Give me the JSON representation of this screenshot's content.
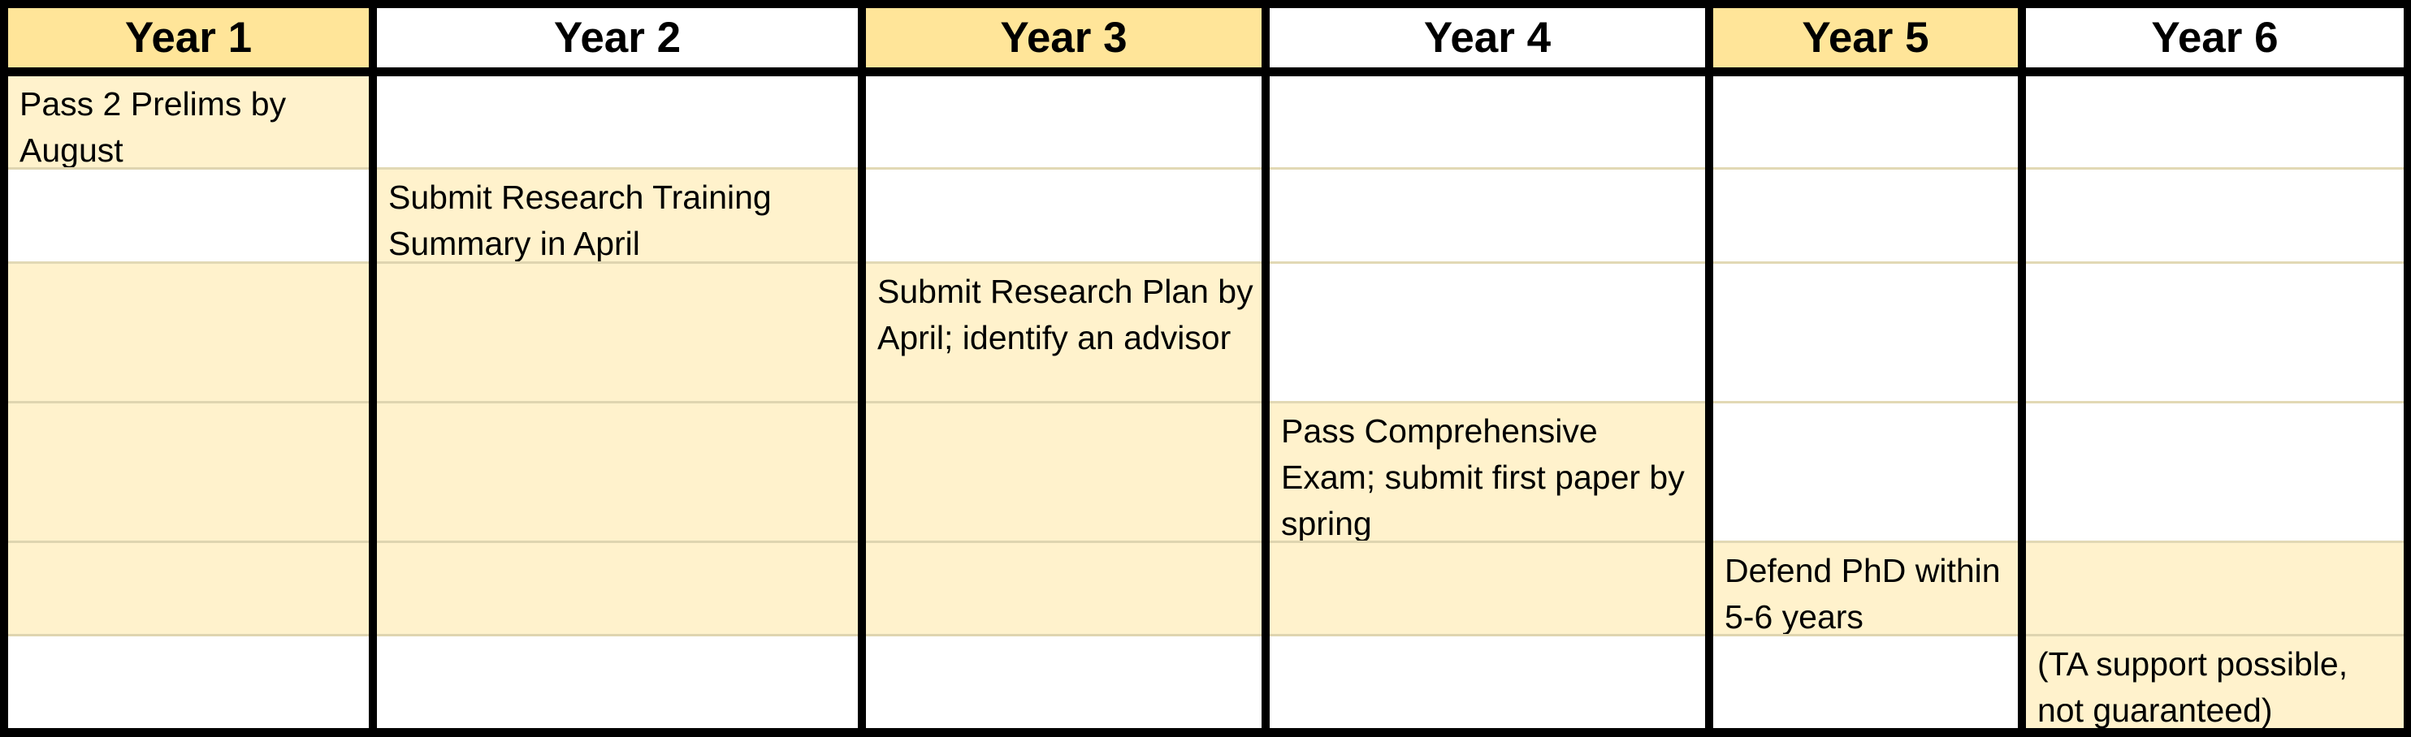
{
  "timeline": {
    "columns": [
      {
        "header": "Year 1",
        "header_highlight": true,
        "cells": [
          {
            "text": "Pass 2 Prelims by August",
            "highlight": true
          },
          {
            "text": "",
            "highlight": false
          },
          {
            "text": "",
            "highlight": true
          },
          {
            "text": "",
            "highlight": true
          },
          {
            "text": "",
            "highlight": true
          },
          {
            "text": "",
            "highlight": false
          }
        ]
      },
      {
        "header": "Year 2",
        "header_highlight": false,
        "cells": [
          {
            "text": "",
            "highlight": false
          },
          {
            "text": "Submit Research Training Summary in April",
            "highlight": true
          },
          {
            "text": "",
            "highlight": true
          },
          {
            "text": "",
            "highlight": true
          },
          {
            "text": "",
            "highlight": true
          },
          {
            "text": "",
            "highlight": false
          }
        ]
      },
      {
        "header": "Year 3",
        "header_highlight": true,
        "cells": [
          {
            "text": "",
            "highlight": false
          },
          {
            "text": "",
            "highlight": false
          },
          {
            "text": "Submit Research Plan by April; identify an advisor",
            "highlight": true
          },
          {
            "text": "",
            "highlight": true
          },
          {
            "text": "",
            "highlight": true
          },
          {
            "text": "",
            "highlight": false
          }
        ]
      },
      {
        "header": "Year 4",
        "header_highlight": false,
        "cells": [
          {
            "text": "",
            "highlight": false
          },
          {
            "text": "",
            "highlight": false
          },
          {
            "text": "",
            "highlight": false
          },
          {
            "text": "Pass Comprehensive Exam; submit first paper by spring",
            "highlight": true
          },
          {
            "text": "",
            "highlight": true
          },
          {
            "text": "",
            "highlight": false
          }
        ]
      },
      {
        "header": "Year 5",
        "header_highlight": true,
        "cells": [
          {
            "text": "",
            "highlight": false
          },
          {
            "text": "",
            "highlight": false
          },
          {
            "text": "",
            "highlight": false
          },
          {
            "text": "",
            "highlight": false
          },
          {
            "text": "Defend PhD within 5-6 years",
            "highlight": true
          },
          {
            "text": "",
            "highlight": false
          }
        ]
      },
      {
        "header": "Year 6",
        "header_highlight": false,
        "cells": [
          {
            "text": "",
            "highlight": false
          },
          {
            "text": "",
            "highlight": false
          },
          {
            "text": "",
            "highlight": false
          },
          {
            "text": "",
            "highlight": false
          },
          {
            "text": "",
            "highlight": true
          },
          {
            "text": "(TA support possible, not guaranteed)",
            "highlight": true
          }
        ]
      }
    ]
  },
  "colors": {
    "header_yellow": "#ffe599",
    "cell_highlight": "#fff2cc",
    "border": "#000000",
    "row_divider": "#e2d9b5"
  }
}
